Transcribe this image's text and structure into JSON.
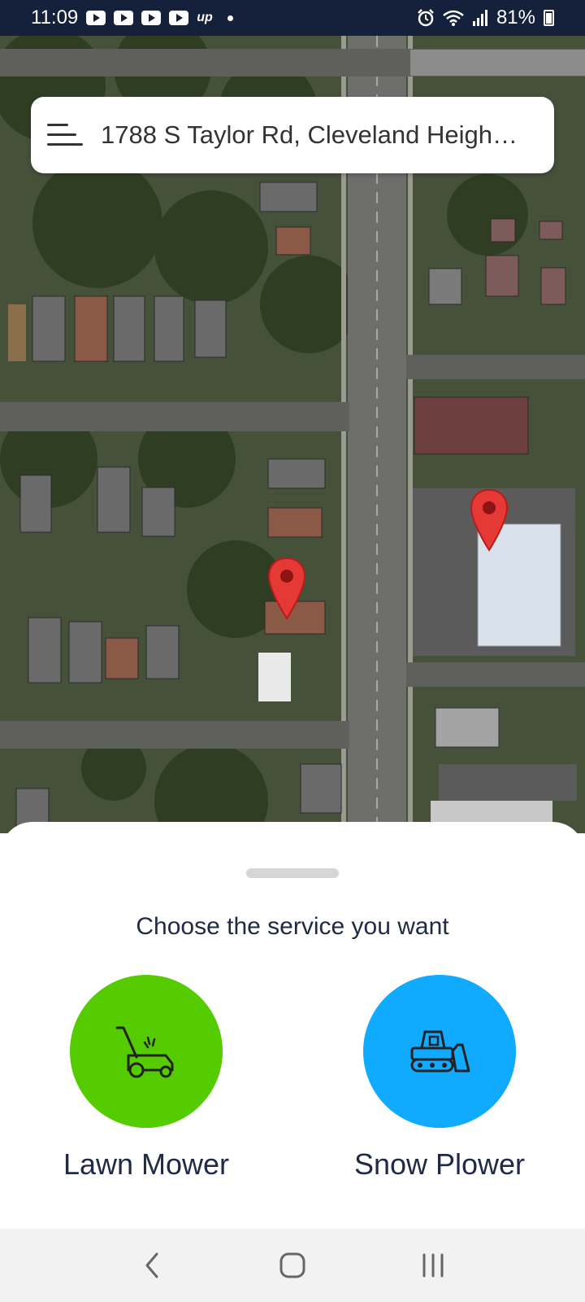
{
  "status_bar": {
    "time": "11:09",
    "battery_percent": "81%",
    "notification_icons": [
      "youtube-icon",
      "youtube-icon",
      "youtube-icon",
      "youtube-icon",
      "up-icon",
      "dot-icon"
    ],
    "system_icons": [
      "alarm-icon",
      "wifi-icon",
      "signal-icon",
      "battery-icon"
    ]
  },
  "search": {
    "address": "1788 S Taylor Rd, Cleveland Height…",
    "menu_icon": "hamburger-menu-icon"
  },
  "map": {
    "pin_color": "#e53935",
    "pins": [
      "location-pin",
      "location-pin"
    ]
  },
  "sheet": {
    "title": "Choose the service you want",
    "services": [
      {
        "label": "Lawn Mower",
        "icon": "lawn-mower-icon",
        "color": "#55cc00"
      },
      {
        "label": "Snow Plower",
        "icon": "snow-plow-icon",
        "color": "#10aaff"
      }
    ]
  },
  "nav": {
    "back_icon": "back-icon",
    "home_icon": "home-icon",
    "recents_icon": "recents-icon"
  }
}
